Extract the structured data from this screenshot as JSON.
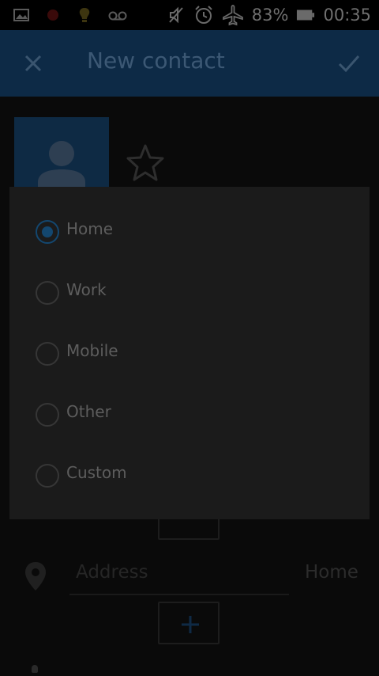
{
  "status_bar": {
    "battery_percent": "83%",
    "time": "00:35",
    "icons": [
      "image-icon",
      "notification-dot-icon",
      "lightbulb-icon",
      "voicemail-icon",
      "mute-icon",
      "alarm-icon",
      "airplane-mode-icon",
      "battery-icon"
    ]
  },
  "app_bar": {
    "title": "New contact",
    "close_icon": "close-icon",
    "save_icon": "checkmark-icon"
  },
  "photo": {
    "icon": "person-icon"
  },
  "favorite": {
    "icon": "star-outline-icon"
  },
  "address": {
    "placeholder": "Address",
    "type": "Home",
    "icon": "location-pin-icon"
  },
  "dialog": {
    "selected": "Home",
    "options": [
      {
        "label": "Home",
        "checked": true
      },
      {
        "label": "Work",
        "checked": false
      },
      {
        "label": "Mobile",
        "checked": false
      },
      {
        "label": "Other",
        "checked": false
      },
      {
        "label": "Custom",
        "checked": false
      }
    ]
  },
  "colors": {
    "app_bar": "#0d2a46",
    "accent": "#13476f",
    "dialog_bg": "#1b1b1b",
    "screen_bg": "#0a0a0a"
  }
}
